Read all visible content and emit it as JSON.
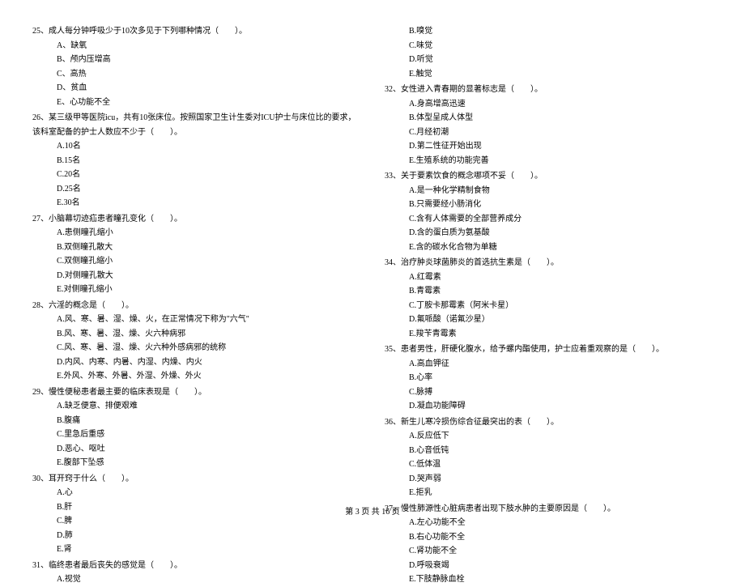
{
  "left_column": {
    "q25": {
      "text": "25、成人每分钟呼吸少于10次多见于下列哪种情况（　　）。",
      "options": [
        "A、缺氧",
        "B、颅内压增高",
        "C、高热",
        "D、贫血",
        "E、心功能不全"
      ]
    },
    "q26": {
      "text": "26、某三级甲等医院icu，共有10张床位。按照国家卫生计生委对ICU护士与床位比的要求，该科室配备的护士人数应不少于（　　）。",
      "options": [
        "A.10名",
        "B.15名",
        "C.20名",
        "D.25名",
        "E.30名"
      ]
    },
    "q27": {
      "text": "27、小脑幕切迹疝患者瞳孔变化（　　）。",
      "options": [
        "A.患侧瞳孔缩小",
        "B.双侧瞳孔散大",
        "C.双侧瞳孔缩小",
        "D.对侧瞳孔散大",
        "E.对侧瞳孔缩小"
      ]
    },
    "q28": {
      "text": "28、六淫的概念是（　　）。",
      "options": [
        "A.风、寒、暑、湿、燥、火，在正常情况下称为\"六气\"",
        "B.风、寒、暑、湿、燥、火六种病邪",
        "C.风、寒、暑、湿、燥、火六种外感病邪的统称",
        "D.内风、内寒、内暑、内湿、内燥、内火",
        "E.外风、外寒、外暑、外湿、外燥、外火"
      ]
    },
    "q29": {
      "text": "29、慢性便秘患者最主要的临床表现是（　　）。",
      "options": [
        "A.缺乏便意、排便艰难",
        "B.腹痛",
        "C.里急后重感",
        "D.恶心、呕吐",
        "E.腹部下坠感"
      ]
    },
    "q30": {
      "text": "30、耳开窍于什么（　　）。",
      "options": [
        "A.心",
        "B.肝",
        "C.脾",
        "D.肺",
        "E.肾"
      ]
    },
    "q31": {
      "text": "31、临终患者最后丧失的感觉是（　　）。",
      "options": [
        "A.视觉"
      ]
    }
  },
  "right_column": {
    "q31_cont": {
      "options": [
        "B.嗅觉",
        "C.味觉",
        "D.听觉",
        "E.触觉"
      ]
    },
    "q32": {
      "text": "32、女性进入青春期的显著标志是（　　）。",
      "options": [
        "A.身高增高迅速",
        "B.体型呈成人体型",
        "C.月经初潮",
        "D.第二性征开始出现",
        "E.生殖系统的功能完善"
      ]
    },
    "q33": {
      "text": "33、关于要素饮食的概念哪项不妥（　　）。",
      "options": [
        "A.是一种化学精制食物",
        "B.只需要经小肠消化",
        "C.含有人体需要的全部营养成分",
        "D.含的蛋白质为氨基酸",
        "E.含的碳水化合物为单糖"
      ]
    },
    "q34": {
      "text": "34、治疗肿炎球菌肺炎的首选抗生素是（　　）。",
      "options": [
        "A.红霉素",
        "B.青霉素",
        "C.丁胺卡那霉素（阿米卡星）",
        "D.氟哌酸（诺氟沙星）",
        "E.羧苄青霉素"
      ]
    },
    "q35": {
      "text": "35、患者男性，肝硬化腹水，给予螺内酯使用，护士应着重观察的是（　　）。",
      "options": [
        "A.高血钾征",
        "B.心率",
        "C.脉搏",
        "D.凝血功能障碍"
      ]
    },
    "q36": {
      "text": "36、新生儿寒冷损伤综合征最突出的表（　　）。",
      "options": [
        "A.反应低下",
        "B.心音低钝",
        "C.低体温",
        "D.哭声弱",
        "E.拒乳"
      ]
    },
    "q37": {
      "text": "37、慢性肺源性心脏病患者出现下肢水肿的主要原因是（　　）。",
      "options": [
        "A.左心功能不全",
        "B.右心功能不全",
        "C.肾功能不全",
        "D.呼吸衰竭",
        "E.下肢静脉血栓"
      ]
    }
  },
  "footer": "第 3 页 共 16 页"
}
